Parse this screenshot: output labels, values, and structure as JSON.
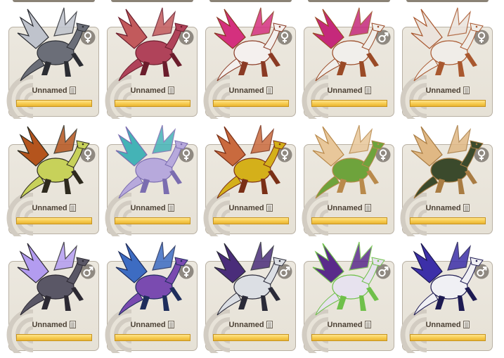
{
  "grid": {
    "cards": [
      {
        "name": "Unnamed",
        "gender": "female",
        "palette": {
          "body": "#6b6e78",
          "wing": "#bfc3cc",
          "accent": "#2b2d33"
        }
      },
      {
        "name": "Unnamed",
        "gender": "female",
        "palette": {
          "body": "#b0435a",
          "wing": "#c25a5c",
          "accent": "#6b1d2c"
        }
      },
      {
        "name": "Unnamed",
        "gender": "female",
        "palette": {
          "body": "#f4f0ee",
          "wing": "#d4307e",
          "accent": "#8a3a24"
        }
      },
      {
        "name": "Unnamed",
        "gender": "male",
        "palette": {
          "body": "#f1efeb",
          "wing": "#c5297b",
          "accent": "#9a4a26"
        }
      },
      {
        "name": "Unnamed",
        "gender": "female",
        "palette": {
          "body": "#f0ede8",
          "wing": "#ebe3dc",
          "accent": "#a9582f"
        }
      },
      {
        "name": "Unnamed",
        "gender": "female",
        "palette": {
          "body": "#c7d15a",
          "wing": "#b4541d",
          "accent": "#2e2a1e"
        }
      },
      {
        "name": "Unnamed",
        "gender": "female",
        "palette": {
          "body": "#b7a9dc",
          "wing": "#44b3b6",
          "accent": "#7b6db0"
        }
      },
      {
        "name": "Unnamed",
        "gender": "female",
        "palette": {
          "body": "#d4b01a",
          "wing": "#c96a3e",
          "accent": "#7a2f16"
        }
      },
      {
        "name": "Unnamed",
        "gender": "female",
        "palette": {
          "body": "#6ea33c",
          "wing": "#e8c79a",
          "accent": "#b98a4c"
        }
      },
      {
        "name": "Unnamed",
        "gender": "female",
        "palette": {
          "body": "#3b4a2c",
          "wing": "#e0b884",
          "accent": "#a97c43"
        }
      },
      {
        "name": "Unnamed",
        "gender": "male",
        "palette": {
          "body": "#5a5766",
          "wing": "#b39cf0",
          "accent": "#2c2933"
        }
      },
      {
        "name": "Unnamed",
        "gender": "female",
        "palette": {
          "body": "#7a4bb0",
          "wing": "#3d6cc2",
          "accent": "#1e2d5c"
        }
      },
      {
        "name": "Unnamed",
        "gender": "male",
        "palette": {
          "body": "#dcdfe4",
          "wing": "#4a2d7a",
          "accent": "#2a2a38"
        }
      },
      {
        "name": "Unnamed",
        "gender": "male",
        "palette": {
          "body": "#e7e2ee",
          "wing": "#5a2a8a",
          "accent": "#6fc04a"
        }
      },
      {
        "name": "Unnamed",
        "gender": "male",
        "palette": {
          "body": "#f0f0f4",
          "wing": "#3c2fa8",
          "accent": "#1d1a52"
        }
      }
    ]
  },
  "ui_colors": {
    "card_border": "#b8b0a3",
    "name_text": "#4d4236",
    "xp_fill": "#f6c94a",
    "gender_circle": "#8f8981"
  }
}
